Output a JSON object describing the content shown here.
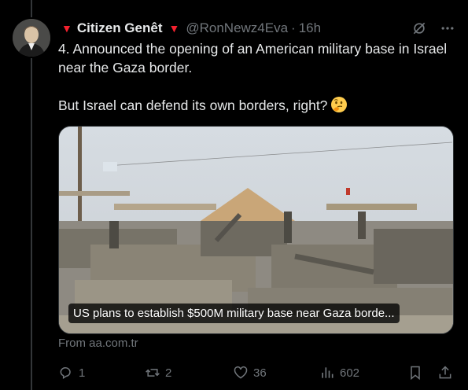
{
  "post": {
    "display_name": "Citizen Genêt",
    "handle": "@RonNewz4Eva",
    "separator": "·",
    "time": "16h",
    "text_line1": "4. Announced the opening of an American military base in Israel near the Gaza border.",
    "text_line2": "But Israel can defend its own borders, right?",
    "emoji_icon": "thinking-face-icon"
  },
  "card": {
    "caption": "US plans to establish $500M military base near Gaza borde...",
    "source": "From aa.com.tr"
  },
  "actions": {
    "replies": "1",
    "reposts": "2",
    "likes": "36",
    "views": "602"
  },
  "colors": {
    "background": "#000000",
    "text": "#e7e9ea",
    "muted": "#71767b",
    "flag_red": "#f4212e"
  }
}
